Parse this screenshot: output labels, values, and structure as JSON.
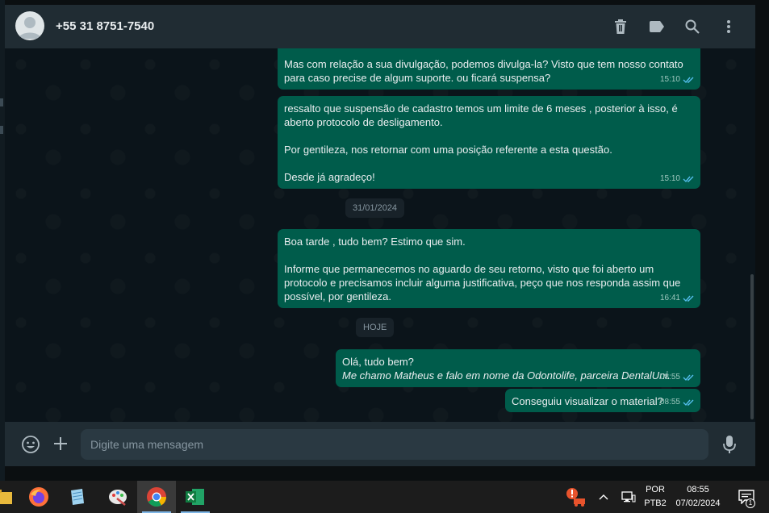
{
  "header": {
    "contact_name": "+55 31 8751-7540",
    "icons": [
      "delete-icon",
      "label-icon",
      "search-icon",
      "menu-icon"
    ]
  },
  "messages": [
    {
      "text": "Mas com relação a sua divulgação, podemos divulga-la? Visto que tem nosso contato\npara caso precise de algum suporte. ou ficará suspensa?",
      "time": "15:10"
    },
    {
      "text": "ressalto que suspensão de cadastro temos um limite de 6 meses , posterior à isso, é\naberto protocolo de desligamento.\n\nPor gentileza, nos retornar com uma posição referente a esta questão.\n\nDesde já agradeço!",
      "time": "15:10"
    },
    {
      "text": "Boa tarde , tudo bem? Estimo que sim.\n\nInforme que permanecemos no aguardo de seu retorno, visto que foi aberto um\nprotocolo e precisamos incluir alguma justificativa, peço que nos responda assim que\npossível, por gentileza.",
      "time": "16:41"
    },
    {
      "text": "Olá, tudo bem?",
      "text_italic": "Me chamo Matheus e falo em nome da Odontolife, parceira DentalUni.",
      "time": "08:55"
    },
    {
      "text": "Conseguiu visualizar o material?",
      "time": "08:55"
    }
  ],
  "dates": {
    "first": "31/01/2024",
    "second": "HOJE"
  },
  "compose": {
    "placeholder": "Digite uma mensagem"
  },
  "taskbar": {
    "apps": [
      "file-explorer-icon",
      "firefox-icon",
      "notepad-icon",
      "paint-icon",
      "chrome-icon",
      "excel-icon"
    ],
    "language": "POR",
    "keyboard": "PTB2",
    "time": "08:55",
    "date": "07/02/2024",
    "notification_count": "1"
  },
  "colors": {
    "outgoing_bubble": "#005c4b",
    "header": "#202c33",
    "background": "#0b141a",
    "tick": "#53bdeb"
  }
}
